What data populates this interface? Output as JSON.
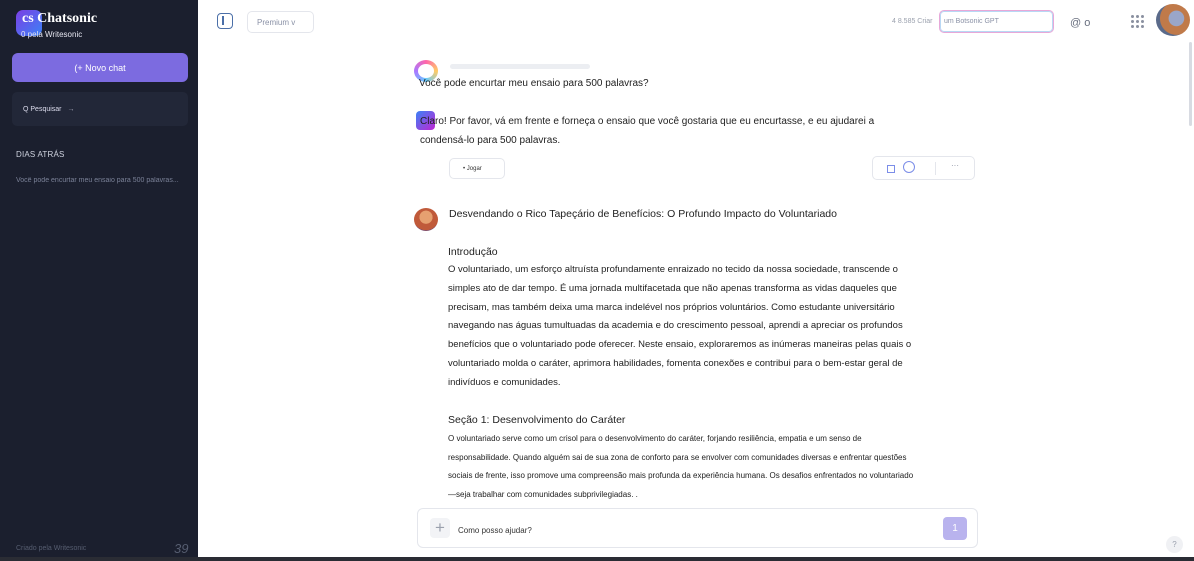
{
  "sidebar": {
    "brand_name": "cs Chatsonic",
    "brand_sub": "0 pela Writesonic",
    "new_chat_label": "(+ Novo chat",
    "search_label": "Q Pesquisar",
    "search_arrow": "→",
    "section_label": "DIAS ATRÁS",
    "history": [
      "Você pode encurtar meu ensaio para 500 palavras..."
    ],
    "footer_credit": "Criado pela Writesonic",
    "footer_count": "39"
  },
  "header": {
    "premium_label": "Premium v",
    "stats": "4 8.585 Criar",
    "botsonic_label": "um Botsonic GPT",
    "at_label": "@ o"
  },
  "conversation": {
    "user_message": "Você pode encurtar meu ensaio para 500 palavras?",
    "bot_message": "Claro! Por favor, vá em frente e forneça o ensaio que você gostaria que eu encurtasse, e eu ajudarei a condensá-lo para 500 palavras.",
    "jogar_label": "• Jogar",
    "more_label": "···",
    "essay_title": "Desvendando o Rico Tapeçário de Benefícios: O Profundo Impacto do Voluntariado",
    "intro_heading": "Introdução",
    "intro_body": "O voluntariado, um esforço altruísta profundamente enraizado no tecido da nossa sociedade, transcende o simples ato de dar tempo. É uma jornada multifacetada que não apenas transforma as vidas daqueles que precisam, mas também deixa uma marca indelével nos próprios voluntários. Como estudante universitário navegando nas águas tumultuadas da academia e do crescimento pessoal, aprendi a apreciar os profundos benefícios que o voluntariado pode oferecer. Neste ensaio, exploraremos as inúmeras maneiras pelas quais o voluntariado molda o caráter, aprimora habilidades, fomenta conexões e contribui para o bem-estar geral de indivíduos e comunidades.",
    "section1_heading": "Seção 1: Desenvolvimento do Caráter",
    "section1_body": "O voluntariado serve como um crisol para o desenvolvimento do caráter, forjando resiliência, empatia e um senso de responsabilidade. Quando alguém sai de sua zona de conforto para se envolver com comunidades diversas e enfrentar questões sociais de frente, isso promove uma compreensão mais profunda da experiência humana. Os desafios enfrentados no voluntariado—seja trabalhar com comunidades subprivilegiadas. ."
  },
  "composer": {
    "placeholder": "Como posso ajudar?",
    "send_label": "1"
  },
  "help_label": "?",
  "icons": [
    "panel-toggle-icon",
    "grid-icon",
    "plus-icon",
    "square-icon",
    "circle-icon",
    "more-icon",
    "help-icon"
  ]
}
